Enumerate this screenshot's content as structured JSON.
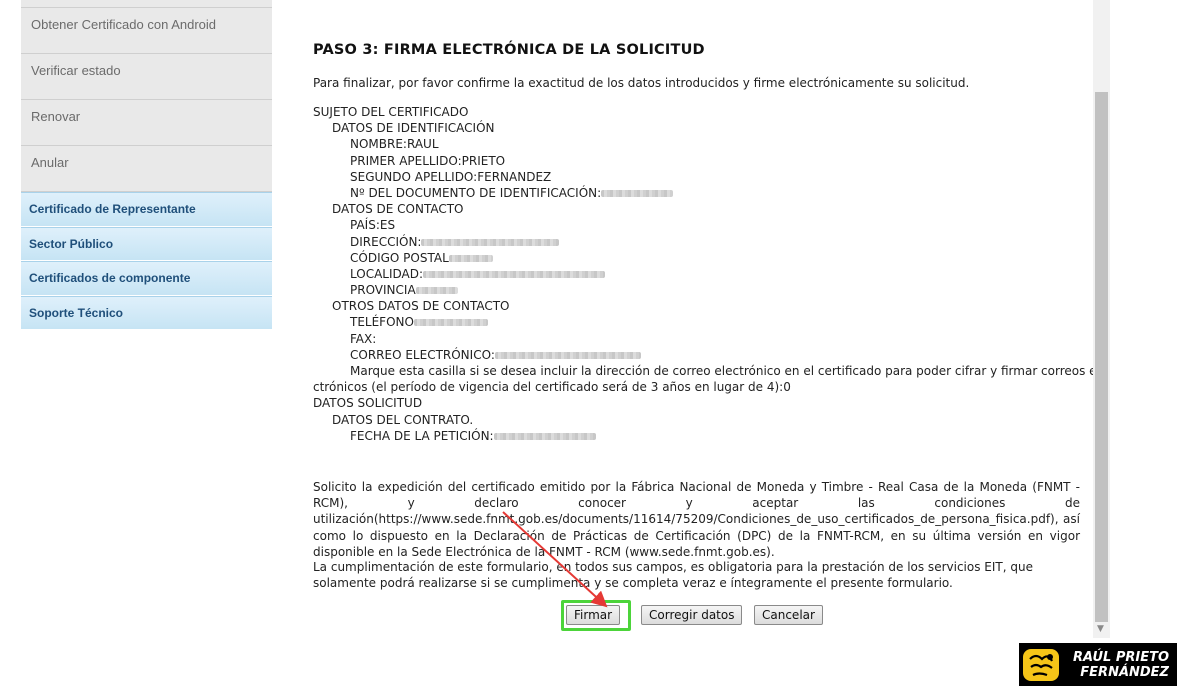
{
  "sidebar": {
    "gray_items": [
      {
        "label": "Obtener Certificado con Android"
      },
      {
        "label": "Verificar estado"
      },
      {
        "label": "Renovar"
      },
      {
        "label": "Anular"
      }
    ],
    "blue_items": [
      {
        "label": "Certificado de Representante"
      },
      {
        "label": "Sector Público"
      },
      {
        "label": "Certificados de componente"
      },
      {
        "label": "Soporte Técnico"
      }
    ]
  },
  "main": {
    "title": "PASO 3: FIRMA ELECTRÓNICA DE LA SOLICITUD",
    "intro": "Para finalizar, por favor confirme la exactitud de los datos introducidos y firme electrónicamente su solicitud.",
    "subject_header": "SUJETO DEL CERTIFICADO",
    "ident_header": "DATOS DE IDENTIFICACIÓN",
    "nombre": "NOMBRE:RAUL",
    "apellido1": "PRIMER APELLIDO:PRIETO",
    "apellido2": "SEGUNDO APELLIDO:FERNANDEZ",
    "documento": "Nº DEL DOCUMENTO DE IDENTIFICACIÓN:",
    "contact_header": "DATOS DE CONTACTO",
    "pais": "PAÍS:ES",
    "direccion": "DIRECCIÓN:",
    "codigo_postal": "CÓDIGO POSTAL",
    "localidad": "LOCALIDAD:",
    "provincia": "PROVINCIA",
    "other_contact_header": "OTROS DATOS DE CONTACTO",
    "telefono": "TELÉFONO",
    "fax": "FAX:",
    "correo": "CORREO ELECTRÓNICO:",
    "checkbox_text_line1": " Marque esta casilla si se desea incluir la dirección de correo electrónico en el certificado para poder cifrar y firmar correos ele",
    "checkbox_text_line2": "ctrónicos (el período de vigencia del certificado será de 3 años en lugar de 4):0",
    "request_header": "DATOS SOLICITUD",
    "contract_header": "DATOS DEL CONTRATO.",
    "fecha": "FECHA DE LA PETICIÓN:",
    "para1": "Solicito la expedición del certificado emitido por la Fábrica Nacional de Moneda y Timbre - Real Casa de la Moneda (FNMT - RCM), y declaro conocer y aceptar las condiciones de utilización(https://www.sede.fnmt.gob.es/documents/11614/75209/Condiciones_de_uso_certificados_de_persona_fisica.pdf), así como lo dispuesto en la Declaración de Prácticas de Certificación (DPC) de la FNMT-RCM, en su última versión en vigor disponible en la Sede Electrónica de la FNMT - RCM (www.sede.fnmt.gob.es).",
    "para2": "La cumplimentación de este formulario, en todos sus campos, es obligatoria para la prestación de los servicios EIT, que solamente podrá realizarse si se cumplimenta y se completa veraz e íntegramente el presente formulario."
  },
  "buttons": {
    "firmar": "Firmar",
    "corregir": "Corregir datos",
    "cancelar": "Cancelar"
  },
  "logo": {
    "line1": "RAÚL PRIETO",
    "line2": "FERNÁNDEZ"
  },
  "colors": {
    "highlight": "#4cd43a",
    "arrow": "#e53935",
    "sidebar_blue_text": "#1f4f7a"
  }
}
